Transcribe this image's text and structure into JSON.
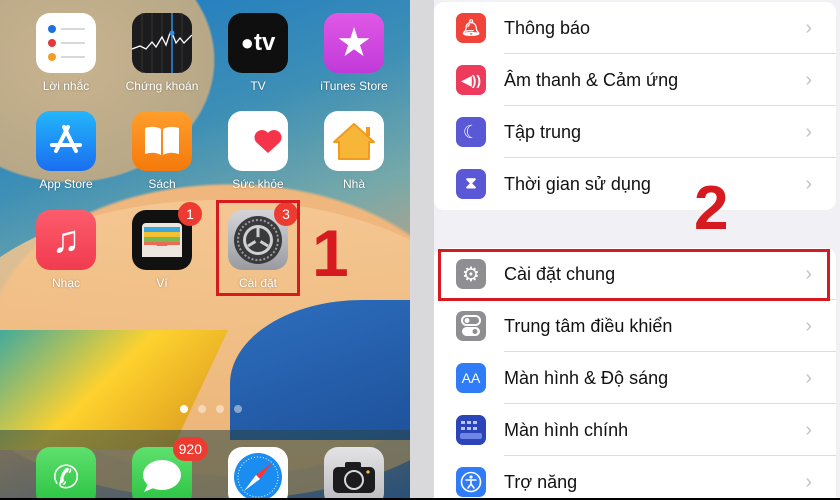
{
  "home_screen": {
    "apps": [
      {
        "label": "Lời nhắc",
        "icon": "reminders-icon"
      },
      {
        "label": "Chứng khoán",
        "icon": "stocks-icon"
      },
      {
        "label": "TV",
        "icon": "apple-tv-icon"
      },
      {
        "label": "iTunes Store",
        "icon": "itunes-store-icon"
      },
      {
        "label": "App Store",
        "icon": "app-store-icon"
      },
      {
        "label": "Sách",
        "icon": "books-icon"
      },
      {
        "label": "Sức khỏe",
        "icon": "health-icon"
      },
      {
        "label": "Nhà",
        "icon": "home-icon"
      },
      {
        "label": "Nhạc",
        "icon": "music-icon"
      },
      {
        "label": "Ví",
        "icon": "wallet-icon",
        "badge": "1"
      },
      {
        "label": "Cài đặt",
        "icon": "settings-gear-icon",
        "badge": "3"
      }
    ],
    "tv_text": "tv",
    "page_dots": {
      "count": 4,
      "active": 1
    },
    "dock": [
      {
        "icon": "phone-icon"
      },
      {
        "icon": "messages-icon",
        "badge": "920"
      },
      {
        "icon": "safari-icon"
      },
      {
        "icon": "camera-icon"
      }
    ],
    "step_label": "1"
  },
  "settings": {
    "step_label": "2",
    "group1": [
      {
        "label": "Thông báo",
        "icon": "notifications-icon",
        "color": "#f0443a"
      },
      {
        "label": "Âm thanh & Cảm ứng",
        "icon": "sound-icon",
        "color": "#ee3a5b"
      },
      {
        "label": "Tập trung",
        "icon": "moon-icon",
        "color": "#5b58d6"
      },
      {
        "label": "Thời gian sử dụng",
        "icon": "hourglass-icon",
        "color": "#5b58d6"
      }
    ],
    "group2": [
      {
        "label": "Cài đặt chung",
        "icon": "gear-icon",
        "color": "#8e8e93"
      },
      {
        "label": "Trung tâm điều khiển",
        "icon": "toggles-icon",
        "color": "#8e8e93"
      },
      {
        "label": "Màn hình & Độ sáng",
        "icon": "text-size-icon",
        "color": "#2f7cf6",
        "glyph": "AA"
      },
      {
        "label": "Màn hình chính",
        "icon": "home-screen-grid-icon",
        "color": "#2b44b8"
      },
      {
        "label": "Trợ năng",
        "icon": "accessibility-icon",
        "color": "#2f7cf6"
      }
    ],
    "chevron": "›"
  },
  "colors": {
    "highlight": "#d61a1f"
  }
}
